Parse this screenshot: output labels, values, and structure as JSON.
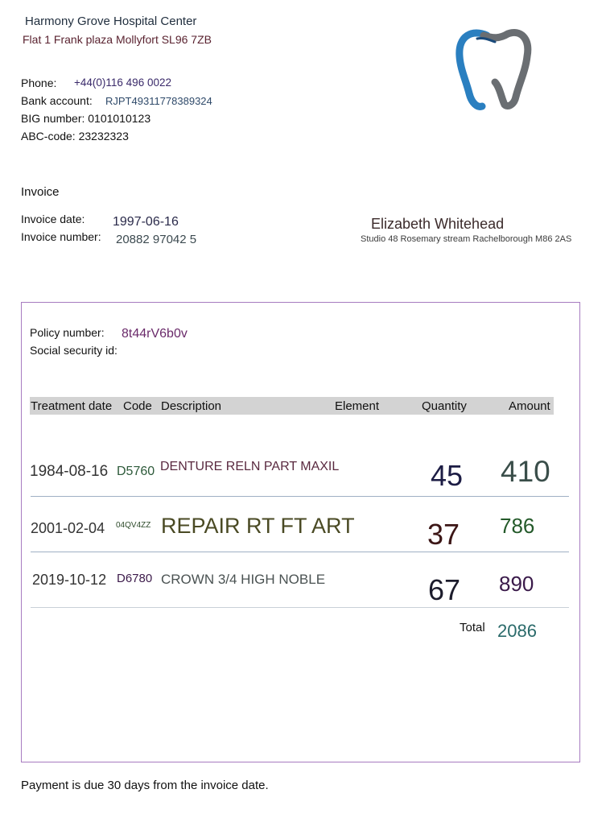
{
  "clinic": {
    "name": "Harmony Grove Hospital Center",
    "address": "Flat 1 Frank plaza Mollyfort SL96 7ZB",
    "phone_label": "Phone:",
    "phone": "+44(0)116 496 0022",
    "bank_label": "Bank account:",
    "bank": "RJPT49311778389324",
    "big": "BIG number: 0101010123",
    "abc": "ABC-code: 23232323",
    "logo_icon": "tooth-logo-icon"
  },
  "invoice": {
    "heading": "Invoice",
    "date_label": "Invoice date:",
    "date": "1997-06-16",
    "number_label": "Invoice number:",
    "number": "20882 97042 5"
  },
  "patient": {
    "name": "Elizabeth Whitehead",
    "address": "Studio 48 Rosemary stream Rachelborough M86 2AS"
  },
  "policy": {
    "number_label": "Policy number:",
    "number": "8t44rV6b0v",
    "ssn_label": "Social security id:"
  },
  "table": {
    "headers": [
      "Treatment date",
      "Code",
      "Description",
      "Element",
      "Quantity",
      "Amount"
    ],
    "rows": [
      {
        "date": "1984-08-16",
        "code": "D5760",
        "description": "DENTURE RELN PART MAXIL",
        "quantity": "45",
        "amount": "410"
      },
      {
        "date": "2001-02-04",
        "code": "04QV4ZZ",
        "description": "REPAIR RT FT ART",
        "quantity": "37",
        "amount": "786"
      },
      {
        "date": "2019-10-12",
        "code": "D6780",
        "description": "CROWN 3/4 HIGH NOBLE",
        "quantity": "67",
        "amount": "890"
      }
    ],
    "total_label": "Total",
    "total": "2086"
  },
  "footer": {
    "note": "Payment is due 30 days from the invoice date."
  },
  "colors": {
    "border": "#a77bc0",
    "header_bg": "#d3d3d3"
  }
}
